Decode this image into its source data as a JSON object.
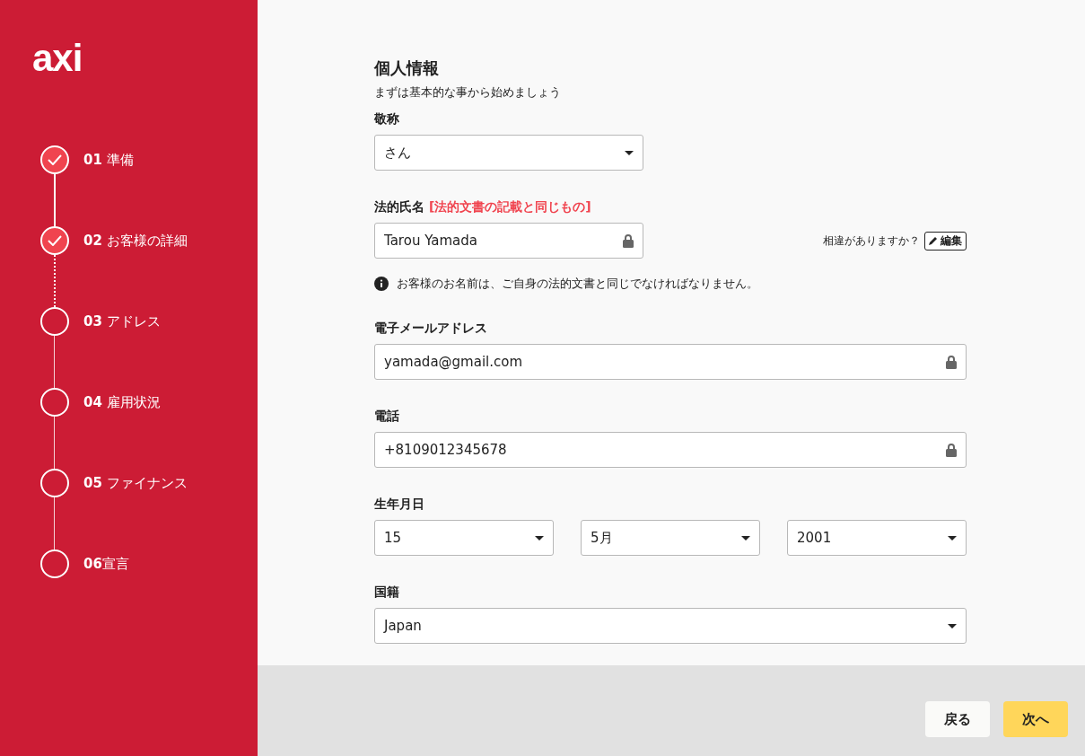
{
  "logo": "axi",
  "steps": [
    {
      "number": "01",
      "label": "準備",
      "done": true
    },
    {
      "number": "02",
      "label": "お客様の詳細",
      "done": true
    },
    {
      "number": "03",
      "label": "アドレス",
      "done": false
    },
    {
      "number": "04",
      "label": "雇用状況",
      "done": false
    },
    {
      "number": "05",
      "label": "ファイナンス",
      "done": false
    },
    {
      "number": "06",
      "label": "宣言",
      "done": false
    }
  ],
  "title": "個人情報",
  "subtitle": "まずは基本的な事から始めましょう",
  "honorific": {
    "label": "敬称",
    "value": "さん"
  },
  "legal_name": {
    "label": "法的氏名",
    "note": "[法的文書の記載と同じもの]",
    "value": "Tarou Yamada",
    "mismatch_text": "相違がありますか？",
    "edit_button": "編集",
    "info": "お客様のお名前は、ご自身の法的文書と同じでなければなりません。"
  },
  "email": {
    "label": "電子メールアドレス",
    "value": "yamada@gmail.com"
  },
  "phone": {
    "label": "電話",
    "value": "+8109012345678"
  },
  "birth_date": {
    "label": "生年月日",
    "day": "15",
    "month": "5月",
    "year": "2001"
  },
  "nationality": {
    "label": "国籍",
    "value": "Japan"
  },
  "buttons": [
    {
      "label": "戻る",
      "kind": "secondary"
    },
    {
      "label": "次へ",
      "kind": "primary"
    }
  ]
}
